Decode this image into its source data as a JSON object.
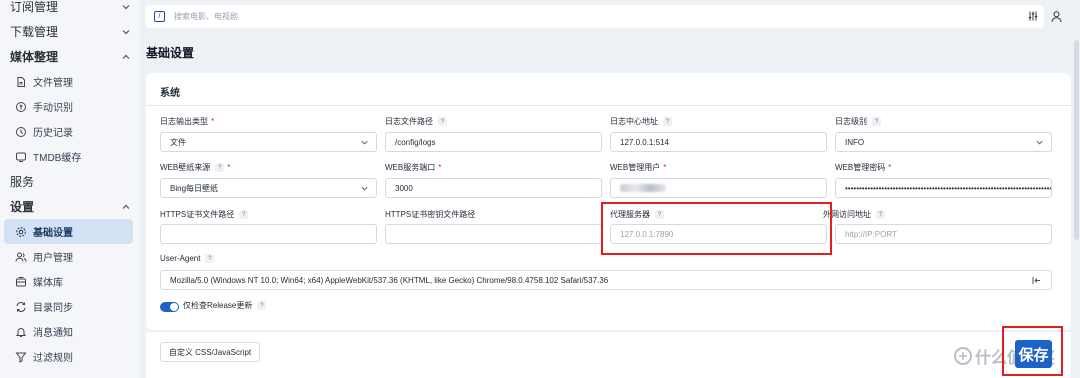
{
  "sidebar": {
    "groups": [
      {
        "label": "订阅管理"
      },
      {
        "label": "下载管理"
      },
      {
        "label": "媒体整理"
      },
      {
        "label": "服务"
      },
      {
        "label": "设置"
      }
    ],
    "media_items": [
      {
        "label": "文件管理",
        "icon": "file-icon"
      },
      {
        "label": "手动识别",
        "icon": "recognize-icon"
      },
      {
        "label": "历史记录",
        "icon": "history-icon"
      },
      {
        "label": "TMDB缓存",
        "icon": "cache-icon"
      }
    ],
    "settings_items": [
      {
        "label": "基础设置",
        "icon": "gear-icon"
      },
      {
        "label": "用户管理",
        "icon": "users-icon"
      },
      {
        "label": "媒体库",
        "icon": "library-icon"
      },
      {
        "label": "目录同步",
        "icon": "sync-icon"
      },
      {
        "label": "消息通知",
        "icon": "bell-icon"
      },
      {
        "label": "过滤规则",
        "icon": "filter-icon"
      }
    ]
  },
  "search": {
    "shortcut": "/",
    "placeholder": "搜索电影、电视剧"
  },
  "page": {
    "title": "基础设置"
  },
  "section": {
    "title": "系统"
  },
  "fields": {
    "log_type": {
      "label": "日志输出类型",
      "required": "*",
      "value": "文件"
    },
    "log_path": {
      "label": "日志文件路径",
      "help": "?",
      "value": "/config/logs"
    },
    "log_center": {
      "label": "日志中心地址",
      "help": "?",
      "value": "127.0.0.1:514"
    },
    "log_level": {
      "label": "日志级别",
      "help": "?",
      "value": "INFO"
    },
    "wallpaper": {
      "label": "WEB壁纸来源",
      "help": "?",
      "required": "*",
      "value": "Bing每日壁纸"
    },
    "web_port": {
      "label": "WEB服务端口",
      "required": "*",
      "value": "3000"
    },
    "web_user": {
      "label": "WEB管理用户",
      "required": "*"
    },
    "web_password": {
      "label": "WEB管理密码",
      "required": "*",
      "value": "••••••••••••••••••••••••••••••••••••••••••••••••••••••••••••••••••••••••••••"
    },
    "https_cert": {
      "label": "HTTPS证书文件路径",
      "help": "?"
    },
    "https_key": {
      "label": "HTTPS证书密钥文件路径"
    },
    "proxy": {
      "label": "代理服务器",
      "help": "?",
      "placeholder": "127.0.0.1:7890"
    },
    "external_url": {
      "label": "外网访问地址",
      "help": "?",
      "placeholder": "http://IP:PORT"
    },
    "user_agent": {
      "label": "User-Agent",
      "help": "?",
      "value": "Mozilla/5.0 (Windows NT 10.0; Win64; x64) AppleWebKit/537.36 (KHTML, like Gecko) Chrome/98.0.4758.102 Safari/537.36"
    }
  },
  "toggle": {
    "label": "仅检查Release更新",
    "help": "?",
    "checked": true
  },
  "footer": {
    "css_button": "自定义 CSS/JavaScript",
    "save_button": "保存"
  },
  "watermark": {
    "text": "什么值得买"
  },
  "colors": {
    "primary": "#1d62c7",
    "highlight": "#e02020",
    "sidebar_active": "#d4e1f5",
    "required": "#e11d48"
  }
}
